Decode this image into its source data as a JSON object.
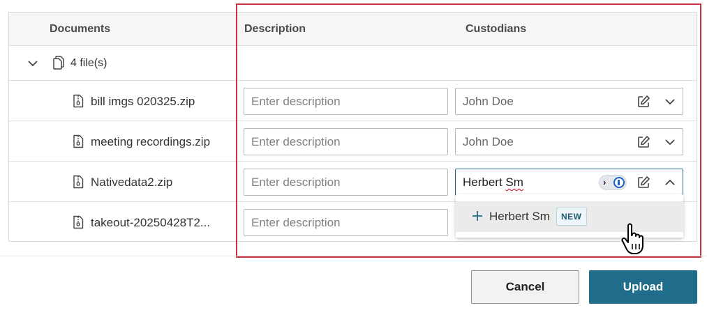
{
  "table": {
    "headers": {
      "documents": "Documents",
      "description": "Description",
      "custodians": "Custodians"
    },
    "group": {
      "label": "4 file(s)",
      "icon": "files-icon",
      "expander_icon": "chevron-down-icon"
    },
    "rows": [
      {
        "file_name": "bill imgs 020325.zip",
        "description_placeholder": "Enter description",
        "description_value": "",
        "custodian": "John Doe"
      },
      {
        "file_name": "meeting recordings.zip",
        "description_placeholder": "Enter description",
        "description_value": "",
        "custodian": "John Doe"
      },
      {
        "file_name": "Nativedata2.zip",
        "description_placeholder": "Enter description",
        "description_value": "",
        "custodian_first": "Herbert",
        "custodian_last": "Sm"
      },
      {
        "file_name": "takeout-20250428T2...",
        "description_placeholder": "Enter description",
        "description_value": ""
      }
    ]
  },
  "dropdown": {
    "option_label": "Herbert Sm",
    "badge": "NEW",
    "icon": "plus-icon"
  },
  "password_manager": {
    "arrow": "›",
    "icon": "password-manager-icon"
  },
  "footer": {
    "cancel_label": "Cancel",
    "upload_label": "Upload"
  },
  "colors": {
    "accent": "#1f6d8a",
    "highlight": "#c8323e",
    "header_bg": "#f7f6f5",
    "dropdown_hover": "#ebebeb"
  }
}
